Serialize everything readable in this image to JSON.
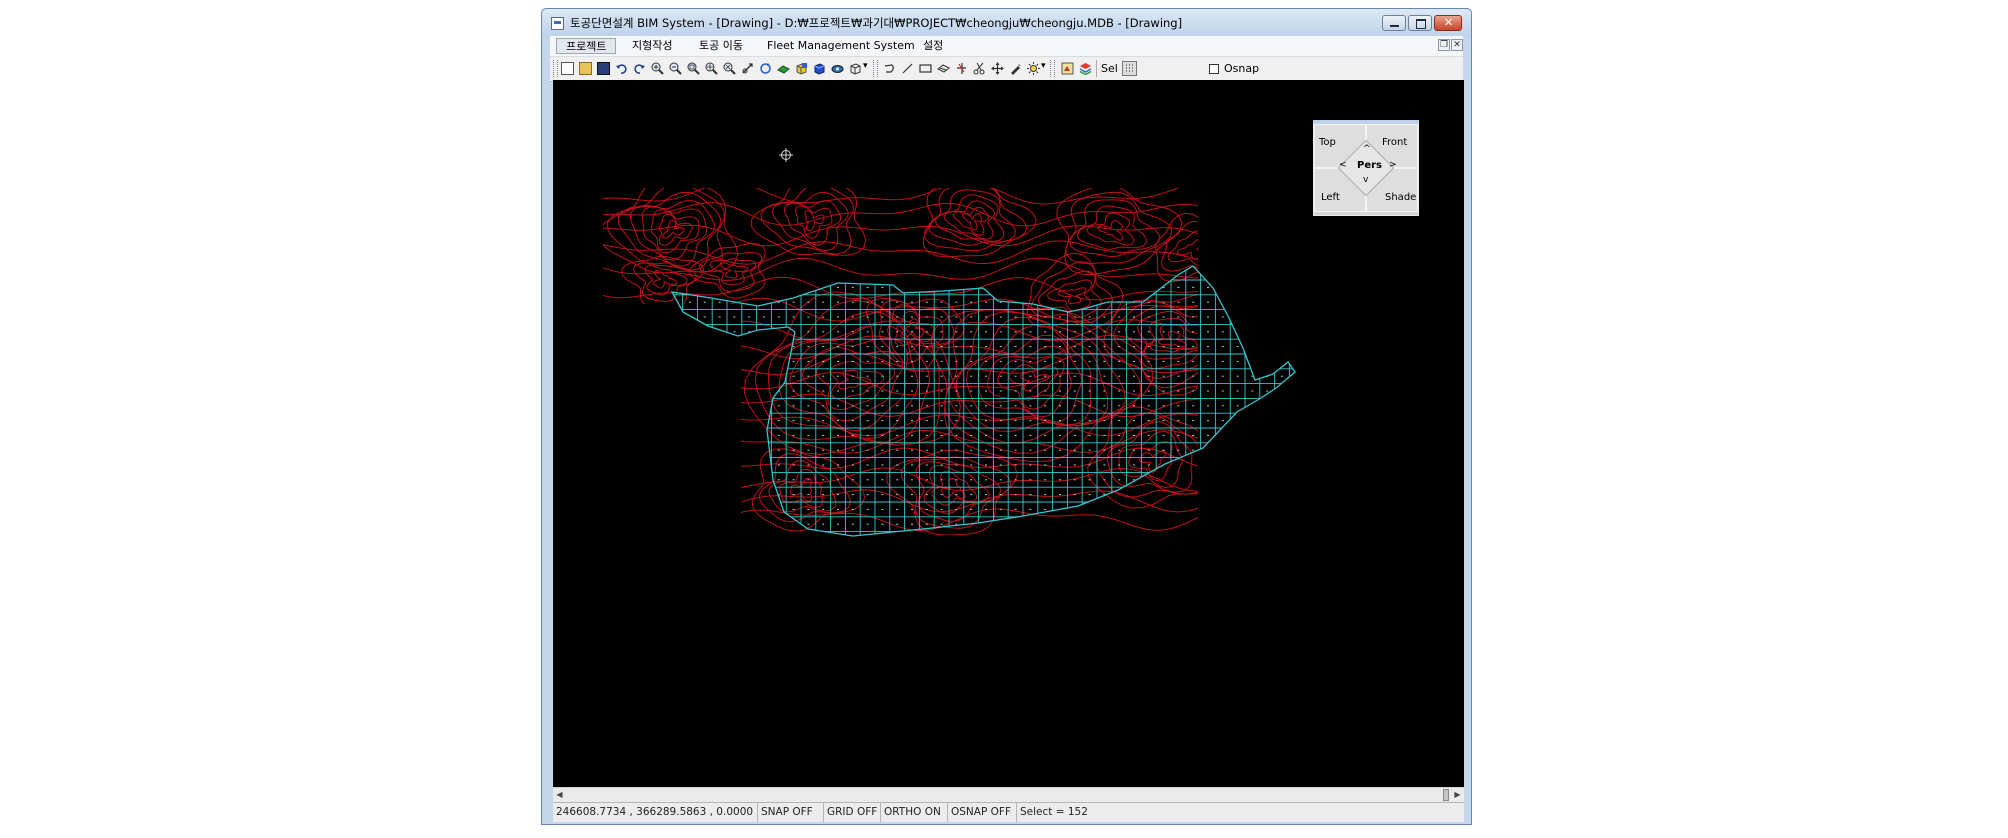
{
  "window": {
    "title": "토공단면설계 BIM System - [Drawing] - D:₩프로젝트₩과기대₩PROJECT₩cheongju₩cheongju.MDB - [Drawing]"
  },
  "menu": {
    "items": [
      {
        "label": "프로젝트"
      },
      {
        "label": "지형작성"
      },
      {
        "label": "토공 이동"
      },
      {
        "label": "Fleet Management System"
      },
      {
        "label": "설정"
      }
    ]
  },
  "toolbar": {
    "sel_label": "Sel",
    "osnap_label": "Osnap",
    "osnap_checked": false
  },
  "viewcube": {
    "top": "Top",
    "front": "Front",
    "left": "Left",
    "shade": "Shade",
    "center": "Pers"
  },
  "status": {
    "coords": "246608.7734 , 366289.5863 , 0.0000",
    "snap": "SNAP OFF",
    "grid": "GRID OFF",
    "ortho": "ORTHO ON",
    "osnap": "OSNAP OFF",
    "select": "Select = 152"
  },
  "colors": {
    "contour": "#c0121a",
    "mesh": "#38c6cf",
    "canvas": "#000000"
  }
}
